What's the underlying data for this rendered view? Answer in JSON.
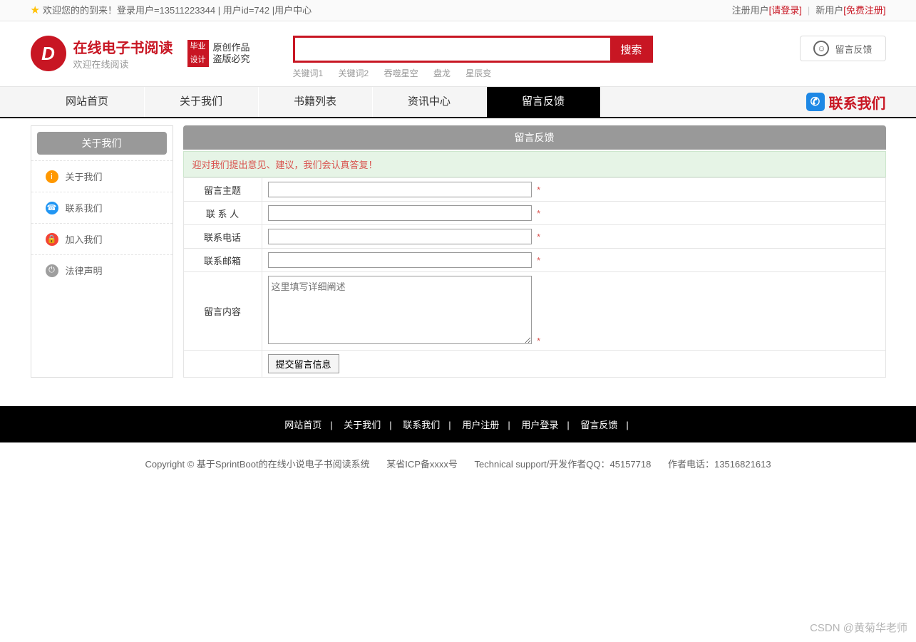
{
  "topbar": {
    "welcome": "欢迎您的的到来！登录用户=13511223344 | 用户id=742 | ",
    "user_center": "用户中心",
    "reg_user": "注册用户",
    "login": "[请登录]",
    "new_user": "新用户",
    "free_reg": "[免费注册]"
  },
  "logo": {
    "mark": "D",
    "title": "在线电子书阅读",
    "sub": "欢迎在线阅读",
    "badge1": "毕业",
    "badge2": "设计",
    "cn1": "原创作品",
    "cn2": "盗版必究"
  },
  "search": {
    "button": "搜索",
    "keywords": [
      "关键词1",
      "关键词2",
      "吞噬星空",
      "盘龙",
      "星辰变"
    ]
  },
  "feedback_button": "留言反馈",
  "nav": {
    "items": [
      "网站首页",
      "关于我们",
      "书籍列表",
      "资讯中心",
      "留言反馈"
    ],
    "active": 4,
    "contact": "联系我们"
  },
  "sidebar": {
    "title": "关于我们",
    "items": [
      {
        "label": "关于我们",
        "icon": "ic-orange",
        "glyph": "i"
      },
      {
        "label": "联系我们",
        "icon": "ic-blue",
        "glyph": "☎"
      },
      {
        "label": "加入我们",
        "icon": "ic-red",
        "glyph": "🔒"
      },
      {
        "label": "法律声明",
        "icon": "ic-grey",
        "glyph": "⏻"
      }
    ]
  },
  "panel": {
    "title": "留言反馈",
    "notice": "迎对我们提出意见、建议，我们会认真答复！",
    "fields": {
      "subject": "留言主题",
      "contact": "联 系 人",
      "phone": "联系电话",
      "email": "联系邮箱",
      "content": "留言内容",
      "placeholder": "这里填写详细阐述"
    },
    "req": "*",
    "submit": "提交留言信息"
  },
  "footer": {
    "links": [
      "网站首页",
      "关于我们",
      "联系我们",
      "用户注册",
      "用户登录",
      "留言反馈"
    ],
    "copy1": "Copyright © 基于SprintBoot的在线小说电子书阅读系统",
    "copy2": "某省ICP备xxxx号",
    "copy3": "Technical support/开发作者QQ：45157718",
    "copy4": "作者电话：13516821613"
  },
  "watermark": "CSDN @黄菊华老师"
}
